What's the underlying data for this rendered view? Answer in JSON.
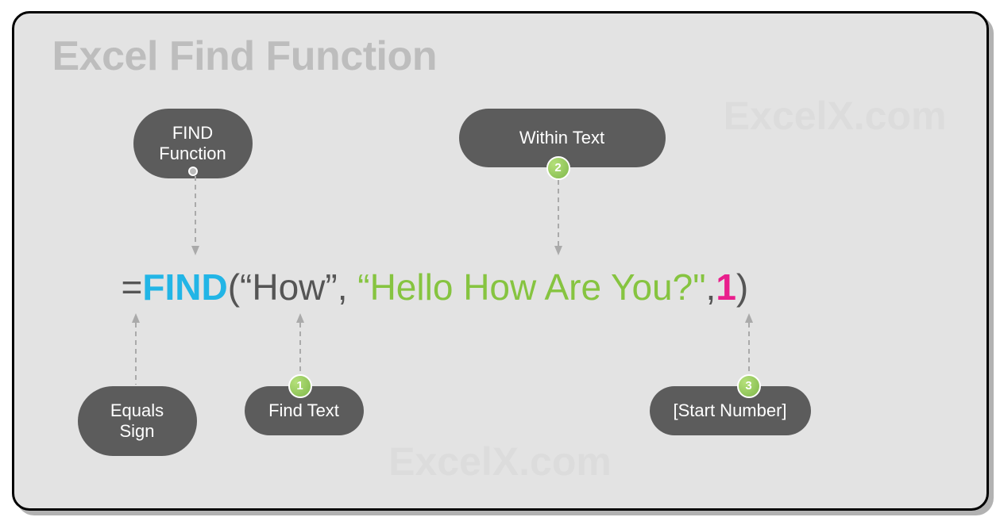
{
  "title": "Excel Find Function",
  "watermark": "ExcelX.com",
  "formula": {
    "equals": "=",
    "fn": "FIND",
    "open": "(",
    "find_text": "“How”",
    "comma1": ", ",
    "within_text": "“Hello How Are You?\"",
    "comma2": ",",
    "start_num": "1",
    "close": ")"
  },
  "labels": {
    "find_function": "FIND Function",
    "within_text": "Within Text",
    "equals_sign": "Equals Sign",
    "find_text": "Find Text",
    "start_number": "[Start Number]"
  },
  "badges": {
    "b1": "1",
    "b2": "2",
    "b3": "3"
  }
}
